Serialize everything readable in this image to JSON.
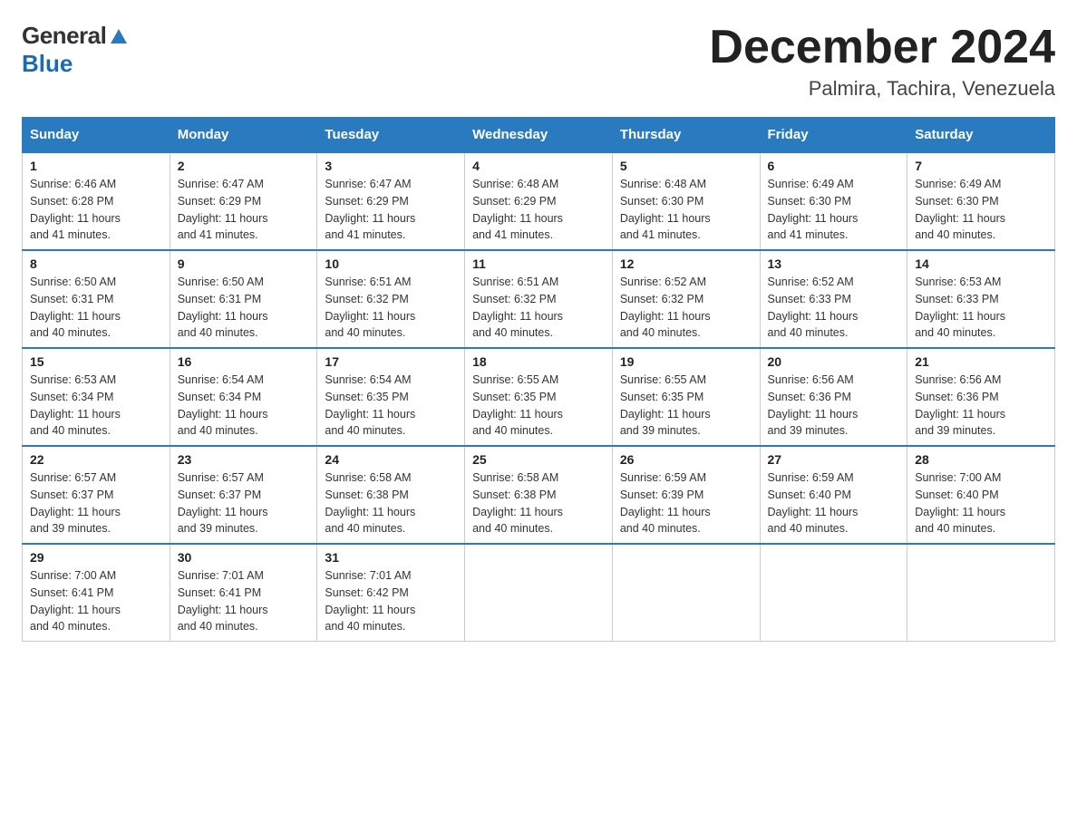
{
  "header": {
    "logo": {
      "general": "General",
      "blue": "Blue"
    },
    "title": "December 2024",
    "location": "Palmira, Tachira, Venezuela"
  },
  "days_of_week": [
    "Sunday",
    "Monday",
    "Tuesday",
    "Wednesday",
    "Thursday",
    "Friday",
    "Saturday"
  ],
  "weeks": [
    [
      {
        "day": "1",
        "sunrise": "6:46 AM",
        "sunset": "6:28 PM",
        "daylight": "11 hours and 41 minutes."
      },
      {
        "day": "2",
        "sunrise": "6:47 AM",
        "sunset": "6:29 PM",
        "daylight": "11 hours and 41 minutes."
      },
      {
        "day": "3",
        "sunrise": "6:47 AM",
        "sunset": "6:29 PM",
        "daylight": "11 hours and 41 minutes."
      },
      {
        "day": "4",
        "sunrise": "6:48 AM",
        "sunset": "6:29 PM",
        "daylight": "11 hours and 41 minutes."
      },
      {
        "day": "5",
        "sunrise": "6:48 AM",
        "sunset": "6:30 PM",
        "daylight": "11 hours and 41 minutes."
      },
      {
        "day": "6",
        "sunrise": "6:49 AM",
        "sunset": "6:30 PM",
        "daylight": "11 hours and 41 minutes."
      },
      {
        "day": "7",
        "sunrise": "6:49 AM",
        "sunset": "6:30 PM",
        "daylight": "11 hours and 40 minutes."
      }
    ],
    [
      {
        "day": "8",
        "sunrise": "6:50 AM",
        "sunset": "6:31 PM",
        "daylight": "11 hours and 40 minutes."
      },
      {
        "day": "9",
        "sunrise": "6:50 AM",
        "sunset": "6:31 PM",
        "daylight": "11 hours and 40 minutes."
      },
      {
        "day": "10",
        "sunrise": "6:51 AM",
        "sunset": "6:32 PM",
        "daylight": "11 hours and 40 minutes."
      },
      {
        "day": "11",
        "sunrise": "6:51 AM",
        "sunset": "6:32 PM",
        "daylight": "11 hours and 40 minutes."
      },
      {
        "day": "12",
        "sunrise": "6:52 AM",
        "sunset": "6:32 PM",
        "daylight": "11 hours and 40 minutes."
      },
      {
        "day": "13",
        "sunrise": "6:52 AM",
        "sunset": "6:33 PM",
        "daylight": "11 hours and 40 minutes."
      },
      {
        "day": "14",
        "sunrise": "6:53 AM",
        "sunset": "6:33 PM",
        "daylight": "11 hours and 40 minutes."
      }
    ],
    [
      {
        "day": "15",
        "sunrise": "6:53 AM",
        "sunset": "6:34 PM",
        "daylight": "11 hours and 40 minutes."
      },
      {
        "day": "16",
        "sunrise": "6:54 AM",
        "sunset": "6:34 PM",
        "daylight": "11 hours and 40 minutes."
      },
      {
        "day": "17",
        "sunrise": "6:54 AM",
        "sunset": "6:35 PM",
        "daylight": "11 hours and 40 minutes."
      },
      {
        "day": "18",
        "sunrise": "6:55 AM",
        "sunset": "6:35 PM",
        "daylight": "11 hours and 40 minutes."
      },
      {
        "day": "19",
        "sunrise": "6:55 AM",
        "sunset": "6:35 PM",
        "daylight": "11 hours and 39 minutes."
      },
      {
        "day": "20",
        "sunrise": "6:56 AM",
        "sunset": "6:36 PM",
        "daylight": "11 hours and 39 minutes."
      },
      {
        "day": "21",
        "sunrise": "6:56 AM",
        "sunset": "6:36 PM",
        "daylight": "11 hours and 39 minutes."
      }
    ],
    [
      {
        "day": "22",
        "sunrise": "6:57 AM",
        "sunset": "6:37 PM",
        "daylight": "11 hours and 39 minutes."
      },
      {
        "day": "23",
        "sunrise": "6:57 AM",
        "sunset": "6:37 PM",
        "daylight": "11 hours and 39 minutes."
      },
      {
        "day": "24",
        "sunrise": "6:58 AM",
        "sunset": "6:38 PM",
        "daylight": "11 hours and 40 minutes."
      },
      {
        "day": "25",
        "sunrise": "6:58 AM",
        "sunset": "6:38 PM",
        "daylight": "11 hours and 40 minutes."
      },
      {
        "day": "26",
        "sunrise": "6:59 AM",
        "sunset": "6:39 PM",
        "daylight": "11 hours and 40 minutes."
      },
      {
        "day": "27",
        "sunrise": "6:59 AM",
        "sunset": "6:40 PM",
        "daylight": "11 hours and 40 minutes."
      },
      {
        "day": "28",
        "sunrise": "7:00 AM",
        "sunset": "6:40 PM",
        "daylight": "11 hours and 40 minutes."
      }
    ],
    [
      {
        "day": "29",
        "sunrise": "7:00 AM",
        "sunset": "6:41 PM",
        "daylight": "11 hours and 40 minutes."
      },
      {
        "day": "30",
        "sunrise": "7:01 AM",
        "sunset": "6:41 PM",
        "daylight": "11 hours and 40 minutes."
      },
      {
        "day": "31",
        "sunrise": "7:01 AM",
        "sunset": "6:42 PM",
        "daylight": "11 hours and 40 minutes."
      },
      null,
      null,
      null,
      null
    ]
  ],
  "labels": {
    "sunrise": "Sunrise:",
    "sunset": "Sunset:",
    "daylight": "Daylight:"
  },
  "colors": {
    "header_bg": "#2a7abf",
    "accent": "#1a6bb5"
  }
}
